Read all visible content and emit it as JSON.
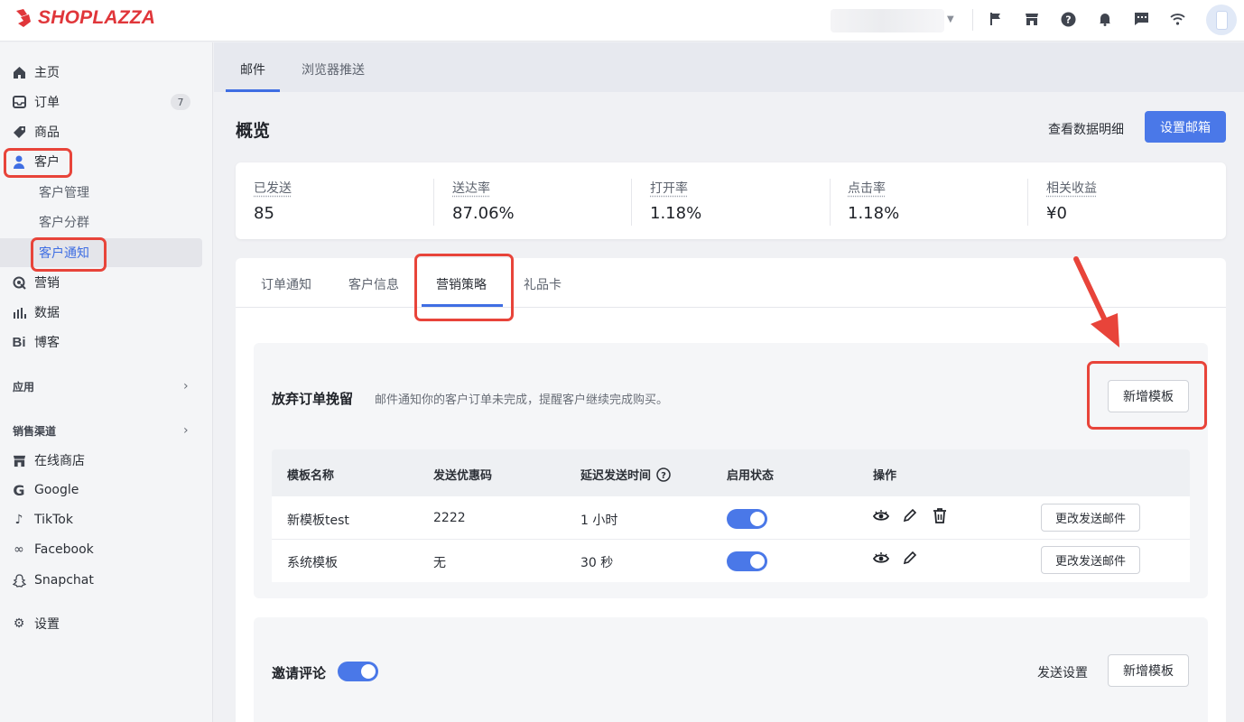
{
  "app": {
    "brand": "SHOPLAZZA"
  },
  "topbar": {
    "icons": [
      "flag-icon",
      "store-icon",
      "help-icon",
      "bell-icon",
      "chat-icon",
      "wifi-icon"
    ]
  },
  "sidebar": {
    "items": [
      {
        "label": "主页",
        "icon": "home-icon"
      },
      {
        "label": "订单",
        "icon": "order-icon",
        "badge": "7"
      },
      {
        "label": "商品",
        "icon": "tag-icon"
      },
      {
        "label": "客户",
        "icon": "person-icon"
      },
      {
        "label": "客户管理"
      },
      {
        "label": "客户分群"
      },
      {
        "label": "客户通知"
      },
      {
        "label": "营销",
        "icon": "marketing-icon"
      },
      {
        "label": "数据",
        "icon": "bar-chart-icon"
      },
      {
        "label": "博客",
        "icon": "blog-icon"
      }
    ],
    "apps_label": "应用",
    "channels_label": "销售渠道",
    "channels": [
      {
        "label": "在线商店",
        "icon": "store-icon"
      },
      {
        "label": "Google",
        "icon": "google-icon"
      },
      {
        "label": "TikTok",
        "icon": "tiktok-icon"
      },
      {
        "label": "Facebook",
        "icon": "facebook-icon"
      },
      {
        "label": "Snapchat",
        "icon": "snapchat-icon"
      }
    ],
    "settings_label": "设置"
  },
  "main_tabs": [
    "邮件",
    "浏览器推送"
  ],
  "overview": {
    "title": "概览",
    "detail_link": "查看数据明细",
    "setup_button": "设置邮箱",
    "stats": [
      {
        "label": "已发送",
        "value": "85"
      },
      {
        "label": "送达率",
        "value": "87.06%"
      },
      {
        "label": "打开率",
        "value": "1.18%"
      },
      {
        "label": "点击率",
        "value": "1.18%"
      },
      {
        "label": "相关收益",
        "value": "¥0"
      }
    ]
  },
  "content_tabs": [
    "订单通知",
    "客户信息",
    "营销策略",
    "礼品卡"
  ],
  "abandoned": {
    "title": "放弃订单挽留",
    "desc": "邮件通知你的客户订单未完成，提醒客户继续完成购买。",
    "add_button": "新增模板",
    "columns": [
      "模板名称",
      "发送优惠码",
      "延迟发送时间",
      "启用状态",
      "操作"
    ],
    "rows": [
      {
        "name": "新模板test",
        "code": "2222",
        "delay": "1 小时",
        "enabled": true,
        "action": "更改发送邮件"
      },
      {
        "name": "系统模板",
        "code": "无",
        "delay": "30 秒",
        "enabled": true,
        "action": "更改发送邮件"
      }
    ]
  },
  "review": {
    "title": "邀请评论",
    "enabled": true,
    "settings_link": "发送设置",
    "add_button": "新增模板"
  },
  "colors": {
    "accent": "#4a78e8",
    "highlight": "#e8443a",
    "brand": "#e0363a"
  }
}
